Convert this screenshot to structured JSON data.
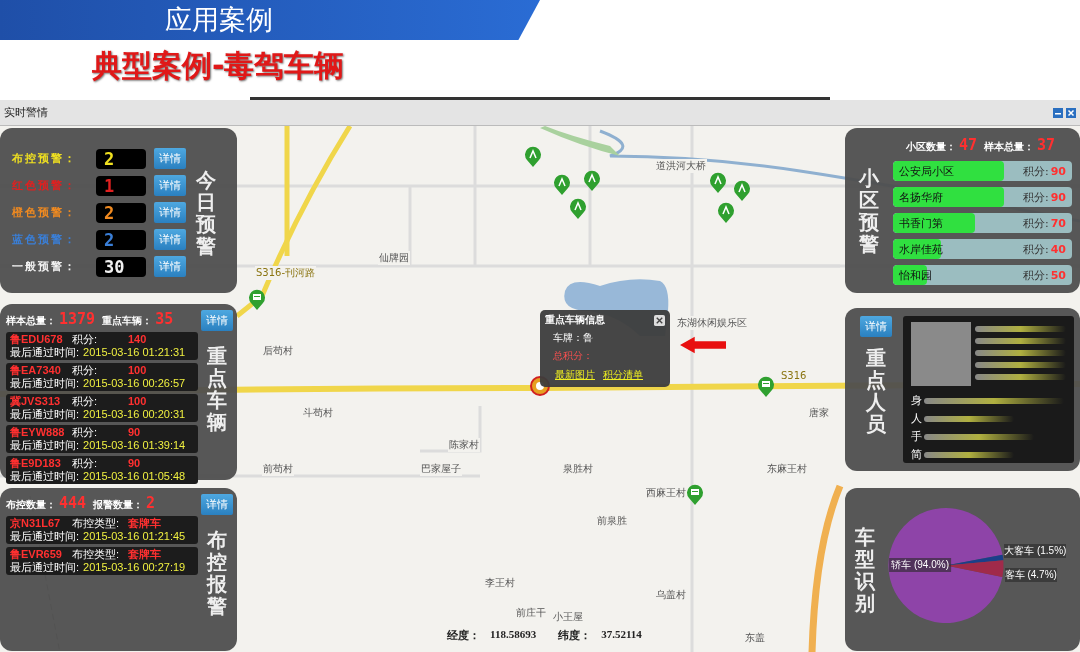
{
  "slide": {
    "section": "应用案例",
    "title": "典型案例-毒驾车辆"
  },
  "window": {
    "title": "实时警情"
  },
  "today_alerts": {
    "title": "今日预警",
    "rows": [
      {
        "label": "布控预警：",
        "count": "2",
        "button": "详情",
        "color": "#f0e020"
      },
      {
        "label": "红色预警：",
        "count": "1",
        "button": "详情",
        "color": "#e02020"
      },
      {
        "label": "橙色预警：",
        "count": "2",
        "button": "详情",
        "color": "#f08a20"
      },
      {
        "label": "蓝色预警：",
        "count": "2",
        "button": "详情",
        "color": "#3a7fd8"
      },
      {
        "label": "一般预警：",
        "count": "30",
        "button": "详情",
        "color": "#f0f0f0"
      }
    ]
  },
  "key_vehicles": {
    "title": "重点车辆",
    "sample_label": "样本总量：",
    "sample_count": "1379",
    "key_label": "重点车辆：",
    "key_count": "35",
    "button": "详情",
    "rows": [
      {
        "plate": "鲁EDU678",
        "score_label": "积分:",
        "score": "140",
        "time_label": "最后通过时间:",
        "time": "2015-03-16 01:21:31"
      },
      {
        "plate": "鲁EA7340",
        "score_label": "积分:",
        "score": "100",
        "time_label": "最后通过时间:",
        "time": "2015-03-16 00:26:57"
      },
      {
        "plate": "冀JVS313",
        "score_label": "积分:",
        "score": "100",
        "time_label": "最后通过时间:",
        "time": "2015-03-16 00:20:31"
      },
      {
        "plate": "鲁EYW888",
        "score_label": "积分:",
        "score": "90",
        "time_label": "最后通过时间:",
        "time": "2015-03-16 01:39:14"
      },
      {
        "plate": "鲁E9D183",
        "score_label": "积分:",
        "score": "90",
        "time_label": "最后通过时间:",
        "time": "2015-03-16 01:05:48"
      }
    ]
  },
  "control_alerts": {
    "title": "布控报警",
    "count_label": "布控数量：",
    "count": "444",
    "alarm_label": "报警数量：",
    "alarm_count": "2",
    "button": "详情",
    "rows": [
      {
        "plate": "京N31L67",
        "type_label": "布控类型:",
        "type": "套牌车",
        "time_label": "最后通过时间:",
        "time": "2015-03-16 01:21:45"
      },
      {
        "plate": "鲁EVR659",
        "type_label": "布控类型:",
        "type": "套牌车",
        "time_label": "最后通过时间:",
        "time": "2015-03-16 00:27:19"
      }
    ]
  },
  "communities": {
    "title": "小区预警",
    "count_label": "小区数量：",
    "count": "47",
    "sample_label": "样本总量：",
    "sample_count": "37",
    "items": [
      {
        "name": "公安局小区",
        "score_label": "积分:",
        "score": "90",
        "level": 0.62
      },
      {
        "name": "名扬华府",
        "score_label": "积分:",
        "score": "90",
        "level": 0.62
      },
      {
        "name": "书香门第",
        "score_label": "积分:",
        "score": "70",
        "level": 0.46
      },
      {
        "name": "水岸佳苑",
        "score_label": "积分:",
        "score": "40",
        "level": 0.27
      },
      {
        "name": "怡和园",
        "score_label": "积分:",
        "score": "50",
        "level": 0.19
      }
    ]
  },
  "key_person": {
    "title": "重点人员",
    "button": "详情",
    "info_labels": [
      "身",
      "人",
      "手",
      "简"
    ]
  },
  "vehicle_types": {
    "title": "车型识别",
    "chart_data": {
      "type": "pie",
      "values": [
        94.0,
        1.5,
        4.7
      ],
      "value_labels": [
        "轿车 (94.0%)",
        "大客车 (1.5%)",
        "客车 (4.7%)"
      ]
    }
  },
  "map": {
    "labels": [
      "道洪河大桥",
      "仙牌园",
      "S316-刊河路",
      "东湖休闲娱乐区",
      "后苟村",
      "S316",
      "斗苟村",
      "唐家",
      "陈家村",
      "前苟村",
      "巴家屋子",
      "泉胜村",
      "东麻王村",
      "西麻王村",
      "前泉胜",
      "李王村",
      "乌盖村",
      "前庄干",
      "小王屋",
      "东盖"
    ]
  },
  "popup": {
    "title": "重点车辆信息",
    "plate_label": "车牌：",
    "plate": "鲁",
    "score_label": "总积分：",
    "links": [
      "最新图片",
      "积分清单"
    ]
  },
  "coordinates": {
    "lon_label": "经度：",
    "lon": "118.58693",
    "lat_label": "纬度：",
    "lat": "37.52114"
  }
}
